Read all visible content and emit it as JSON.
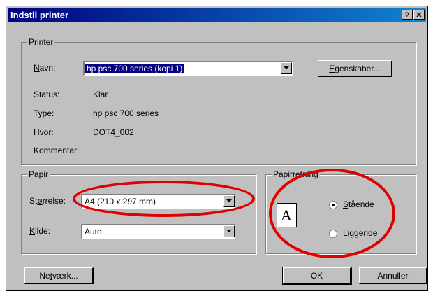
{
  "window": {
    "title": "Indstil printer",
    "help_label": "?",
    "close_label": "✕"
  },
  "printer_group": {
    "legend": "Printer",
    "name_label_u": "N",
    "name_label_rest": "avn:",
    "name_value": "hp psc 700 series (kopi 1)",
    "properties_u": "E",
    "properties_rest": "genskaber...",
    "status_label": "Status:",
    "status_value": "Klar",
    "type_label": "Type:",
    "type_value": "hp psc 700 series",
    "where_label": "Hvor:",
    "where_value": "DOT4_002",
    "comment_label": "Kommentar:"
  },
  "paper_group": {
    "legend": "Papir",
    "size_label_pre": "St",
    "size_label_u": "ø",
    "size_label_post": "rrelse:",
    "size_value": "A4 (210 x 297 mm)",
    "source_label_u": "K",
    "source_label_rest": "ilde:",
    "source_value": "Auto"
  },
  "orientation_group": {
    "legend": "Papirretning",
    "icon_letter": "A",
    "portrait_u": "S",
    "portrait_rest": "tående",
    "portrait_selected": true,
    "landscape_u": "L",
    "landscape_rest": "iggende"
  },
  "buttons": {
    "network_pre": "Ne",
    "network_u": "t",
    "network_post": "værk...",
    "ok": "OK",
    "cancel": "Annuller"
  },
  "colors": {
    "annotation": "#e00000",
    "titlebar": "#000080"
  }
}
